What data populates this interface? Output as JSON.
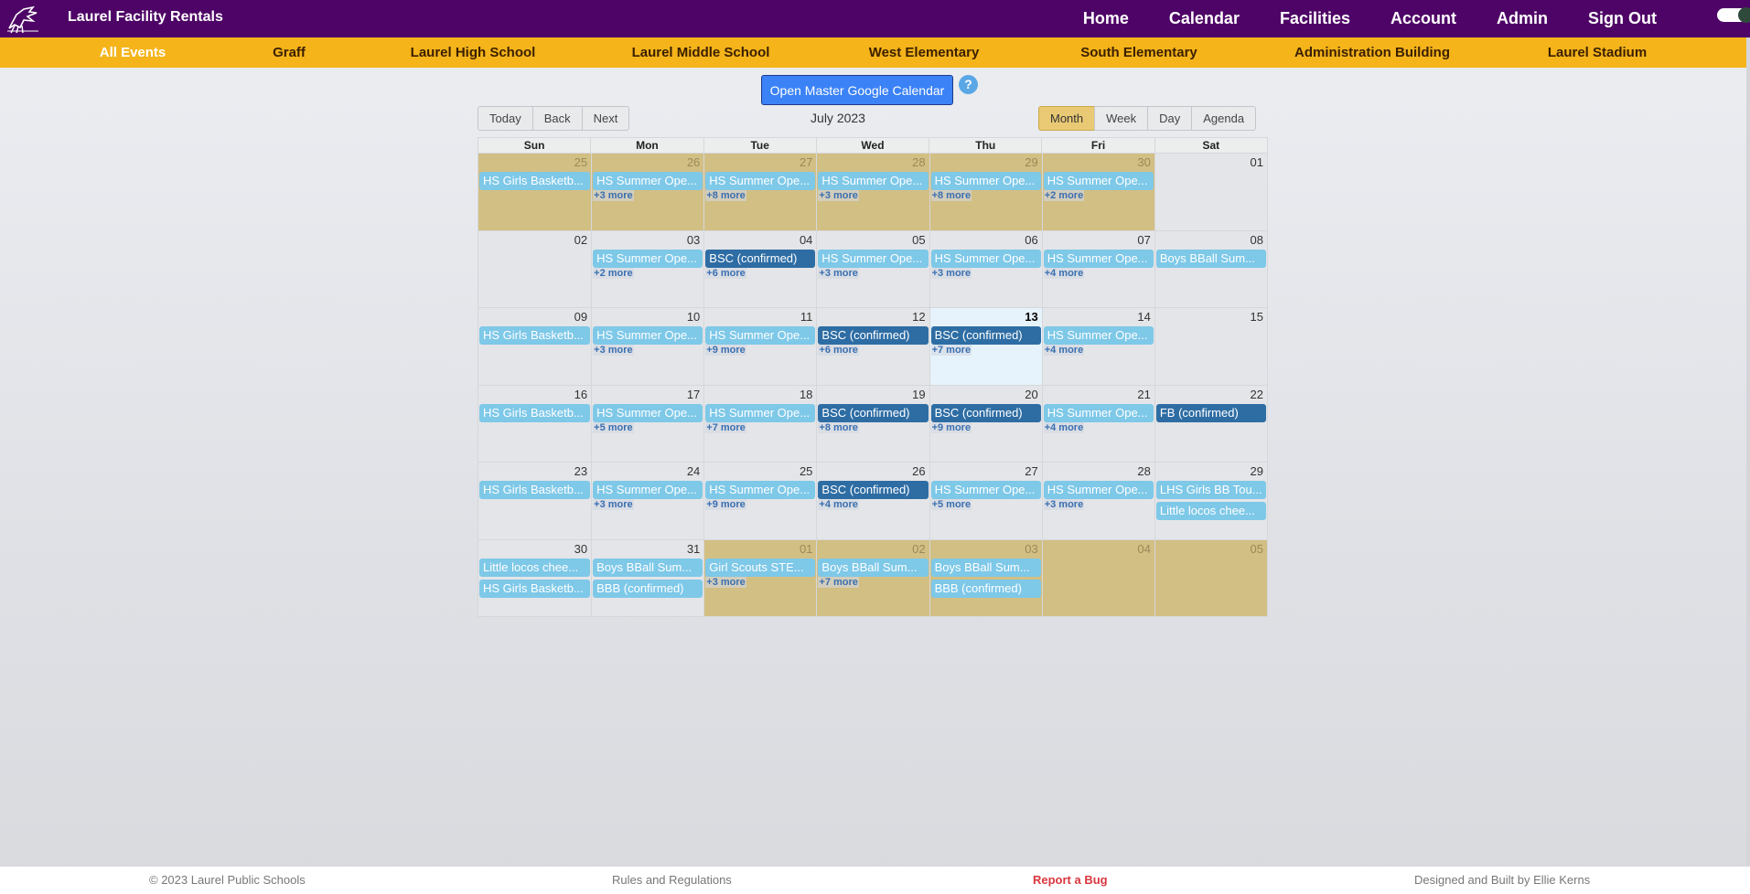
{
  "header": {
    "brand": "Laurel Facility Rentals",
    "nav": [
      "Home",
      "Calendar",
      "Facilities",
      "Account",
      "Admin",
      "Sign Out"
    ]
  },
  "subnav": {
    "items": [
      "All Events",
      "Graff",
      "Laurel High School",
      "Laurel Middle School",
      "West Elementary",
      "South Elementary",
      "Administration Building",
      "Laurel Stadium"
    ],
    "active": "All Events"
  },
  "toolbar": {
    "gcal_button": "Open Master Google Calendar",
    "help": "?",
    "nav_buttons": [
      "Today",
      "Back",
      "Next"
    ],
    "label": "July 2023",
    "view_buttons": [
      "Month",
      "Week",
      "Day",
      "Agenda"
    ],
    "active_view": "Month"
  },
  "calendar": {
    "weekdays": [
      "Sun",
      "Mon",
      "Tue",
      "Wed",
      "Thu",
      "Fri",
      "Sat"
    ],
    "weeks": [
      [
        {
          "d": "25",
          "off": true,
          "events": [
            {
              "t": "HS Girls Basketb...",
              "c": false
            }
          ],
          "more": ""
        },
        {
          "d": "26",
          "off": true,
          "events": [
            {
              "t": "HS Summer Ope...",
              "c": false
            }
          ],
          "more": "+3 more"
        },
        {
          "d": "27",
          "off": true,
          "events": [
            {
              "t": "HS Summer Ope...",
              "c": false
            }
          ],
          "more": "+8 more"
        },
        {
          "d": "28",
          "off": true,
          "events": [
            {
              "t": "HS Summer Ope...",
              "c": false
            }
          ],
          "more": "+3 more"
        },
        {
          "d": "29",
          "off": true,
          "events": [
            {
              "t": "HS Summer Ope...",
              "c": false
            }
          ],
          "more": "+8 more"
        },
        {
          "d": "30",
          "off": true,
          "events": [
            {
              "t": "HS Summer Ope...",
              "c": false
            }
          ],
          "more": "+2 more"
        },
        {
          "d": "01",
          "off": false,
          "events": [],
          "more": ""
        }
      ],
      [
        {
          "d": "02",
          "off": false,
          "events": [],
          "more": ""
        },
        {
          "d": "03",
          "off": false,
          "events": [
            {
              "t": "HS Summer Ope...",
              "c": false
            }
          ],
          "more": "+2 more"
        },
        {
          "d": "04",
          "off": false,
          "events": [
            {
              "t": "BSC (confirmed)",
              "c": true
            }
          ],
          "more": "+6 more"
        },
        {
          "d": "05",
          "off": false,
          "events": [
            {
              "t": "HS Summer Ope...",
              "c": false
            }
          ],
          "more": "+3 more"
        },
        {
          "d": "06",
          "off": false,
          "events": [
            {
              "t": "HS Summer Ope...",
              "c": false
            }
          ],
          "more": "+3 more"
        },
        {
          "d": "07",
          "off": false,
          "events": [
            {
              "t": "HS Summer Ope...",
              "c": false
            }
          ],
          "more": "+4 more"
        },
        {
          "d": "08",
          "off": false,
          "events": [
            {
              "t": "Boys BBall Sum...",
              "c": false
            }
          ],
          "more": ""
        }
      ],
      [
        {
          "d": "09",
          "off": false,
          "events": [
            {
              "t": "HS Girls Basketb...",
              "c": false
            }
          ],
          "more": ""
        },
        {
          "d": "10",
          "off": false,
          "events": [
            {
              "t": "HS Summer Ope...",
              "c": false
            }
          ],
          "more": "+3 more"
        },
        {
          "d": "11",
          "off": false,
          "events": [
            {
              "t": "HS Summer Ope...",
              "c": false
            }
          ],
          "more": "+9 more"
        },
        {
          "d": "12",
          "off": false,
          "events": [
            {
              "t": "BSC (confirmed)",
              "c": true
            }
          ],
          "more": "+6 more"
        },
        {
          "d": "13",
          "off": false,
          "today": true,
          "events": [
            {
              "t": "BSC (confirmed)",
              "c": true
            }
          ],
          "more": "+7 more"
        },
        {
          "d": "14",
          "off": false,
          "events": [
            {
              "t": "HS Summer Ope...",
              "c": false
            }
          ],
          "more": "+4 more"
        },
        {
          "d": "15",
          "off": false,
          "events": [],
          "more": ""
        }
      ],
      [
        {
          "d": "16",
          "off": false,
          "events": [
            {
              "t": "HS Girls Basketb...",
              "c": false
            }
          ],
          "more": ""
        },
        {
          "d": "17",
          "off": false,
          "events": [
            {
              "t": "HS Summer Ope...",
              "c": false
            }
          ],
          "more": "+5 more"
        },
        {
          "d": "18",
          "off": false,
          "events": [
            {
              "t": "HS Summer Ope...",
              "c": false
            }
          ],
          "more": "+7 more"
        },
        {
          "d": "19",
          "off": false,
          "events": [
            {
              "t": "BSC (confirmed)",
              "c": true
            }
          ],
          "more": "+8 more"
        },
        {
          "d": "20",
          "off": false,
          "events": [
            {
              "t": "BSC (confirmed)",
              "c": true
            }
          ],
          "more": "+9 more"
        },
        {
          "d": "21",
          "off": false,
          "events": [
            {
              "t": "HS Summer Ope...",
              "c": false
            }
          ],
          "more": "+4 more"
        },
        {
          "d": "22",
          "off": false,
          "events": [
            {
              "t": "FB (confirmed)",
              "c": true
            }
          ],
          "more": ""
        }
      ],
      [
        {
          "d": "23",
          "off": false,
          "events": [
            {
              "t": "HS Girls Basketb...",
              "c": false
            }
          ],
          "more": ""
        },
        {
          "d": "24",
          "off": false,
          "events": [
            {
              "t": "HS Summer Ope...",
              "c": false
            }
          ],
          "more": "+3 more"
        },
        {
          "d": "25",
          "off": false,
          "events": [
            {
              "t": "HS Summer Ope...",
              "c": false
            }
          ],
          "more": "+9 more"
        },
        {
          "d": "26",
          "off": false,
          "events": [
            {
              "t": "BSC (confirmed)",
              "c": true
            }
          ],
          "more": "+4 more"
        },
        {
          "d": "27",
          "off": false,
          "events": [
            {
              "t": "HS Summer Ope...",
              "c": false
            }
          ],
          "more": "+5 more"
        },
        {
          "d": "28",
          "off": false,
          "events": [
            {
              "t": "HS Summer Ope...",
              "c": false
            }
          ],
          "more": "+3 more"
        },
        {
          "d": "29",
          "off": false,
          "events": [
            {
              "t": "LHS Girls BB Tou...",
              "c": false
            },
            {
              "t": "Little locos chee...",
              "c": false
            }
          ],
          "more": ""
        }
      ],
      [
        {
          "d": "30",
          "off": false,
          "events": [
            {
              "t": "Little locos chee...",
              "c": false
            },
            {
              "t": "HS Girls Basketb...",
              "c": false
            }
          ],
          "more": ""
        },
        {
          "d": "31",
          "off": false,
          "events": [
            {
              "t": "Boys BBall Sum...",
              "c": false
            },
            {
              "t": "BBB (confirmed)",
              "c": false
            }
          ],
          "more": ""
        },
        {
          "d": "01",
          "off": true,
          "events": [
            {
              "t": "Girl Scouts STE...",
              "c": false
            }
          ],
          "more": "+3 more"
        },
        {
          "d": "02",
          "off": true,
          "events": [
            {
              "t": "Boys BBall Sum...",
              "c": false
            }
          ],
          "more": "+7 more"
        },
        {
          "d": "03",
          "off": true,
          "events": [
            {
              "t": "Boys BBall Sum...",
              "c": false
            },
            {
              "t": "BBB (confirmed)",
              "c": false
            }
          ],
          "more": ""
        },
        {
          "d": "04",
          "off": true,
          "events": [],
          "more": ""
        },
        {
          "d": "05",
          "off": true,
          "events": [],
          "more": ""
        }
      ]
    ]
  },
  "footer": {
    "copyright": "© 2023 Laurel Public Schools",
    "rules": "Rules and Regulations",
    "bug": "Report a Bug",
    "credit": "Designed and Built by Ellie Kerns"
  },
  "colors": {
    "header_bg": "#4e0466",
    "subnav_bg": "#f4b41a",
    "event_bg": "#7ec8e8",
    "confirmed_bg": "#2e6da4",
    "offmonth_bg": "#d2bf84",
    "today_bg": "#e7f3fc"
  }
}
